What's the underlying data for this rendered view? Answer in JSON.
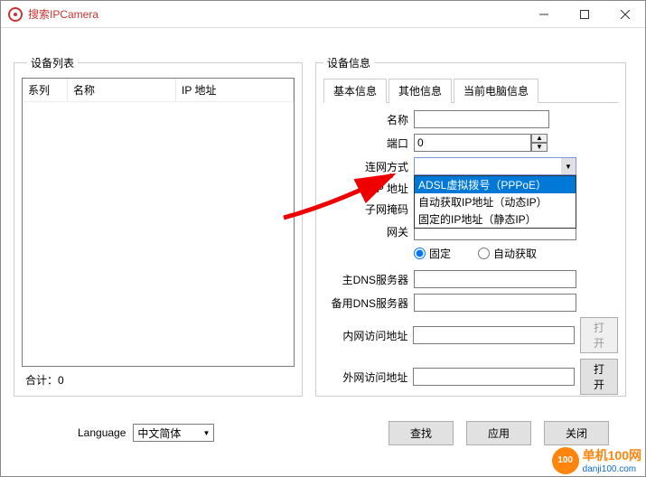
{
  "window": {
    "title": "搜索IPCamera"
  },
  "deviceList": {
    "legend": "设备列表",
    "columns": {
      "series": "系列",
      "name": "名称",
      "ip": "IP 地址"
    },
    "totalLabel": "合计：0"
  },
  "deviceInfo": {
    "legend": "设备信息",
    "tabs": {
      "basic": "基本信息",
      "other": "其他信息",
      "pc": "当前电脑信息"
    },
    "labels": {
      "name": "名称",
      "port": "端口",
      "netmode": "连网方式",
      "ip": "IP 地址",
      "mask": "子网掩码",
      "gateway": "网关",
      "dns1": "主DNS服务器",
      "dns2": "备用DNS服务器",
      "lan": "内网访问地址",
      "wan": "外网访问地址"
    },
    "values": {
      "name": "",
      "port": "0",
      "ip": "",
      "mask": "",
      "gateway": "",
      "dns1": "",
      "dns2": "",
      "lan": "",
      "wan": ""
    },
    "netmodeOptions": {
      "pppoe": "ADSL虚拟拨号（PPPoE）",
      "dhcp": "自动获取IP地址（动态IP）",
      "static": "固定的IP地址（静态IP）"
    },
    "radio": {
      "fixed": "固定",
      "auto": "自动获取"
    },
    "open": "打开"
  },
  "language": {
    "label": "Language",
    "value": "中文简体"
  },
  "buttons": {
    "search": "查找",
    "apply": "应用",
    "close": "关闭"
  },
  "watermark": {
    "brand": "单机100网",
    "url": "danji100.com"
  }
}
